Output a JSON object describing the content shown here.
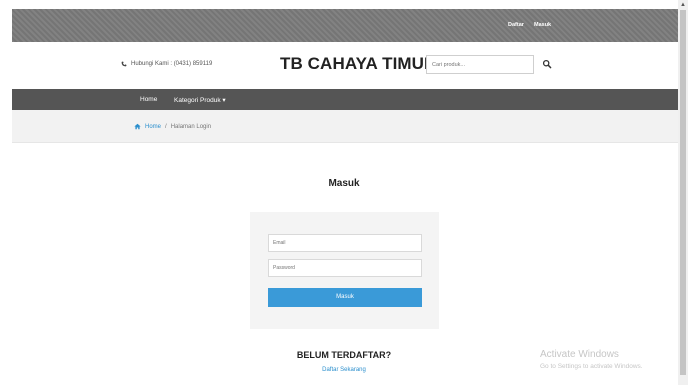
{
  "topbar": {
    "register": "Daftar",
    "login": "Masuk"
  },
  "header": {
    "contact": "Hubungi Kami : (0431) 859119",
    "brand": "TB CAHAYA TIMUR",
    "search_placeholder": "Cari produk..."
  },
  "nav": {
    "home": "Home",
    "categories": "Kategori Produk ▾"
  },
  "breadcrumb": {
    "home": "Home",
    "separator": "/",
    "current": "Halaman Login"
  },
  "login": {
    "title": "Masuk",
    "email_placeholder": "Email",
    "password_placeholder": "Password",
    "submit": "Masuk"
  },
  "register": {
    "heading": "BELUM TERDAFTAR?",
    "link": "Daftar Sekarang"
  },
  "watermark": {
    "line1": "Activate Windows",
    "line2": "Go to Settings to activate Windows."
  },
  "colors": {
    "accent": "#3a9ad8",
    "nav": "#555555",
    "topbar": "#7b7b7b"
  },
  "icons": [
    "phone-icon",
    "search-icon",
    "home-icon"
  ]
}
